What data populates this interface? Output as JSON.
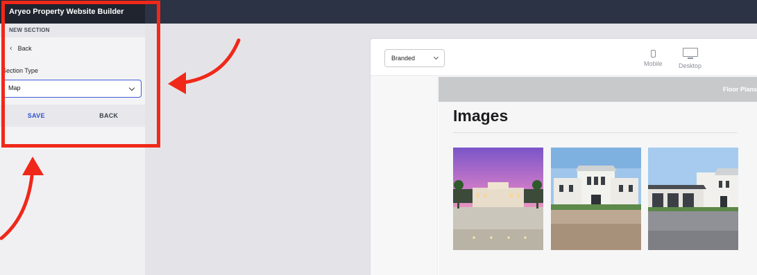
{
  "app": {
    "title": "Aryeo Property Website Builder"
  },
  "sidebar": {
    "section_header": "NEW SECTION",
    "back_link": "Back",
    "section_type_label": "Section Type",
    "section_type_value": "Map",
    "save_label": "SAVE",
    "back_button_label": "BACK"
  },
  "preview": {
    "theme_value": "Branded",
    "view_mobile": "Mobile",
    "view_desktop": "Desktop",
    "nav_link": "Floor Plans",
    "images_heading": "Images",
    "photos": [
      "property-photo-dusk",
      "property-photo-front",
      "property-photo-garage"
    ]
  },
  "colors": {
    "topbar": "#2c3344",
    "accent": "#3b5bd6",
    "annotation": "#f0281a"
  },
  "icons": [
    "chevron-left-icon",
    "chevron-down-icon",
    "mobile-icon",
    "desktop-icon",
    "arrow-annotation"
  ]
}
